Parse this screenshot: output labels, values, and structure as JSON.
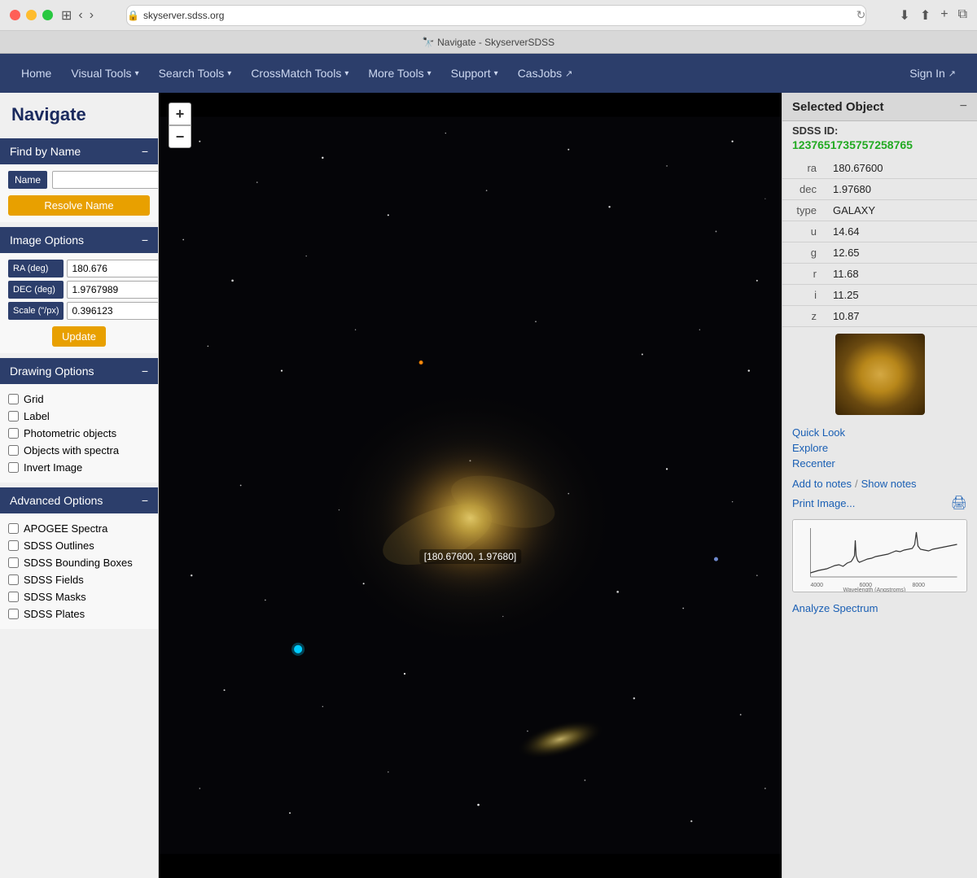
{
  "browser": {
    "url": "skyserver.sdss.org",
    "tab_title": "Navigate - SkyserverSDSS",
    "favicon": "🔒"
  },
  "navbar": {
    "home": "Home",
    "visual_tools": "Visual Tools",
    "search_tools": "Search Tools",
    "crossmatch_tools": "CrossMatch Tools",
    "more_tools": "More Tools",
    "support": "Support",
    "casjobs": "CasJobs",
    "sign_in": "Sign In"
  },
  "sidebar": {
    "title": "Navigate",
    "find_by_name": {
      "label": "Find by Name",
      "name_label": "Name",
      "name_placeholder": "",
      "resolve_btn": "Resolve Name"
    },
    "image_options": {
      "label": "Image Options",
      "ra_label": "RA (deg)",
      "ra_value": "180.676",
      "dec_label": "DEC (deg)",
      "dec_value": "1.9767989",
      "scale_label": "Scale (\"/px)",
      "scale_value": "0.396123",
      "update_btn": "Update"
    },
    "drawing_options": {
      "label": "Drawing Options",
      "checkboxes": [
        {
          "id": "grid",
          "label": "Grid",
          "checked": false
        },
        {
          "id": "label",
          "label": "Label",
          "checked": false
        },
        {
          "id": "photometric",
          "label": "Photometric objects",
          "checked": false
        },
        {
          "id": "spectra",
          "label": "Objects with spectra",
          "checked": false
        },
        {
          "id": "invert",
          "label": "Invert Image",
          "checked": false
        }
      ]
    },
    "advanced_options": {
      "label": "Advanced Options",
      "checkboxes": [
        {
          "id": "apogee",
          "label": "APOGEE Spectra",
          "checked": false
        },
        {
          "id": "outlines",
          "label": "SDSS Outlines",
          "checked": false
        },
        {
          "id": "bounding",
          "label": "SDSS Bounding Boxes",
          "checked": false
        },
        {
          "id": "fields",
          "label": "SDSS Fields",
          "checked": false
        },
        {
          "id": "masks",
          "label": "SDSS Masks",
          "checked": false
        },
        {
          "id": "plates",
          "label": "SDSS Plates",
          "checked": false
        }
      ]
    }
  },
  "map": {
    "zoom_in": "+",
    "zoom_out": "−",
    "coord_label": "[180.67600, 1.97680]"
  },
  "right_panel": {
    "title": "Selected Object",
    "sdss_label": "SDSS ID:",
    "sdss_id": "1237651735757258765",
    "properties": [
      {
        "key": "ra",
        "value": "180.67600"
      },
      {
        "key": "dec",
        "value": "1.97680"
      },
      {
        "key": "type",
        "value": "GALAXY"
      },
      {
        "key": "u",
        "value": "14.64"
      },
      {
        "key": "g",
        "value": "12.65"
      },
      {
        "key": "r",
        "value": "11.68"
      },
      {
        "key": "i",
        "value": "11.25"
      },
      {
        "key": "z",
        "value": "10.87"
      }
    ],
    "links": {
      "quick_look": "Quick Look",
      "explore": "Explore",
      "recenter": "Recenter",
      "add_to_notes": "Add to notes",
      "show_notes": "Show notes",
      "print_image": "Print Image...",
      "analyze_spectrum": "Analyze Spectrum"
    }
  }
}
